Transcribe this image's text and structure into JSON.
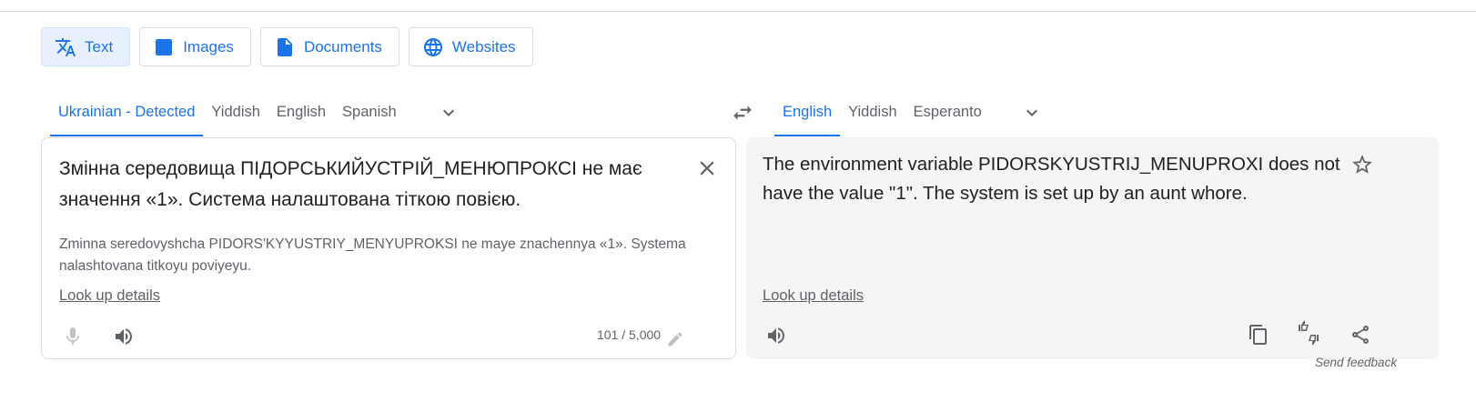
{
  "modes": [
    {
      "label": "Text",
      "icon": "translate-icon",
      "active": true
    },
    {
      "label": "Images",
      "icon": "image-icon"
    },
    {
      "label": "Documents",
      "icon": "document-icon"
    },
    {
      "label": "Websites",
      "icon": "globe-icon"
    }
  ],
  "source_langs": [
    "Ukrainian - Detected",
    "Yiddish",
    "English",
    "Spanish"
  ],
  "target_langs": [
    "English",
    "Yiddish",
    "Esperanto"
  ],
  "source": {
    "text": "Змінна середовища ПІДОРСЬКИЙУСТРІЙ_МЕНЮПРОКСІ не має значення «1». Система налаштована тіткою повією.",
    "transliteration": "Zminna seredovyshcha PIDORS'KYYUSTRIY_MENYUPROKSI ne maye znachennya «1». Systema nalashtovana titkoyu poviyeyu.",
    "lookup": "Look up details",
    "char_count": "101 / 5,000"
  },
  "target": {
    "text": "The environment variable PIDORSKYUSTRIJ_MENUPROXI does not have the value \"1\". The system is set up by an aunt whore.",
    "lookup": "Look up details"
  },
  "feedback": "Send feedback",
  "colors": {
    "accent": "#1a73e8",
    "active_bg": "#e8f0fe",
    "target_panel_bg": "#f5f5f5",
    "muted_text": "#5f6368",
    "border": "#dadce0"
  }
}
